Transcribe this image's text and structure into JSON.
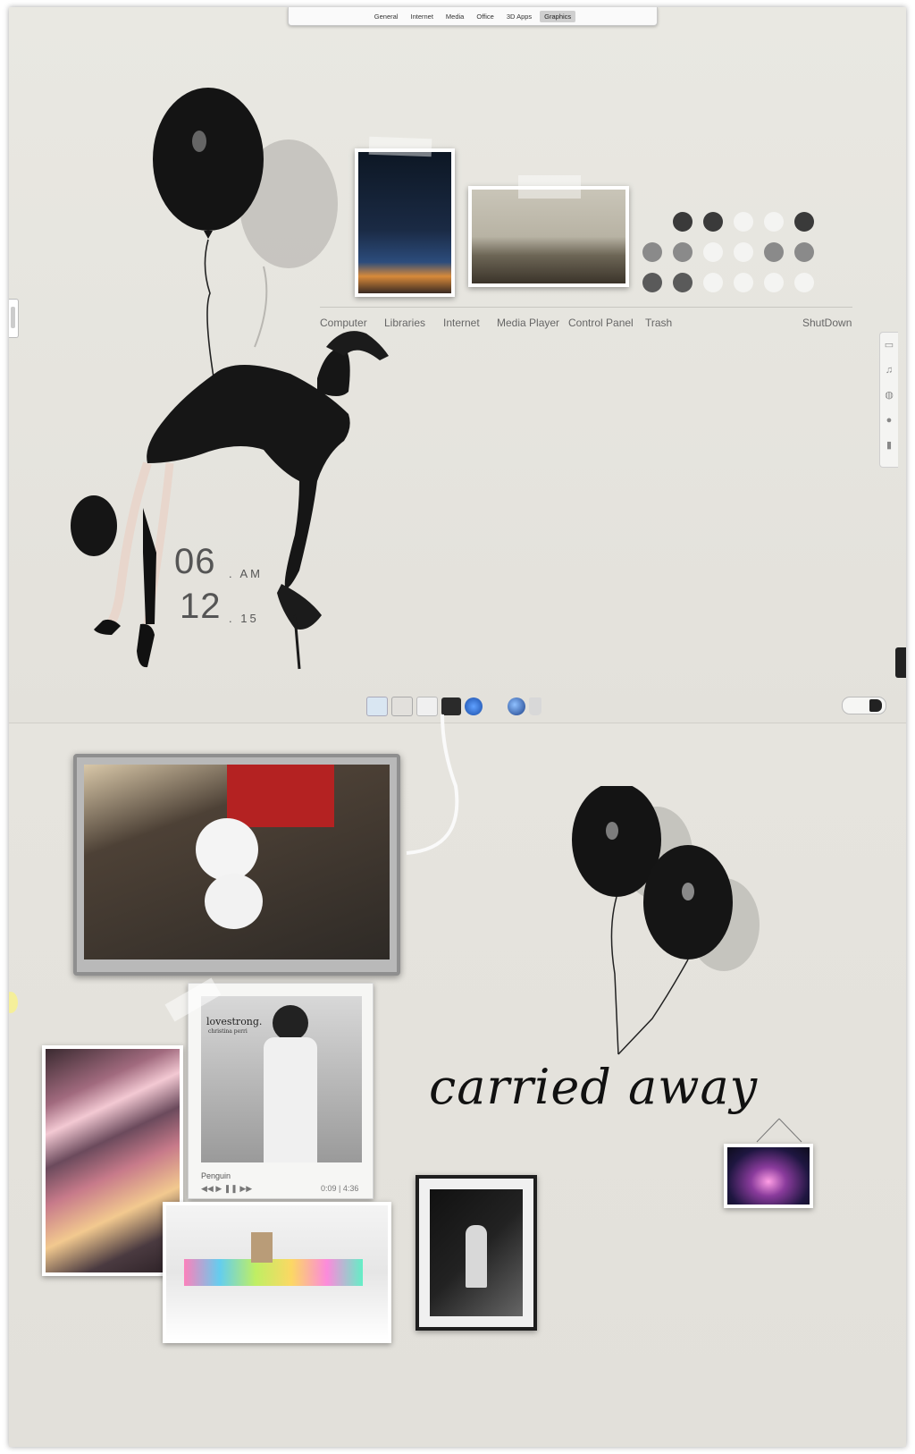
{
  "top_tabs": [
    {
      "label": "General",
      "active": false
    },
    {
      "label": "Internet",
      "active": false
    },
    {
      "label": "Media",
      "active": false
    },
    {
      "label": "Office",
      "active": false
    },
    {
      "label": "3D Apps",
      "active": false
    },
    {
      "label": "Graphics",
      "active": true
    }
  ],
  "launcher": {
    "items": [
      "Computer",
      "Libraries",
      "Internet",
      "Media Player",
      "Control Panel",
      "Trash"
    ],
    "shutdown_label": "ShutDown"
  },
  "clock": {
    "hour": "06",
    "ampm": ". AM",
    "minute": "12",
    "seconds": ". 15"
  },
  "right_bar_icons": [
    "monitor-icon",
    "music-icon",
    "globe-icon",
    "chat-icon",
    "trash-icon"
  ],
  "dock_icons": [
    "skype-icon",
    "photos-icon",
    "documents-icon",
    "media-icon",
    "refresh-icon",
    "globe-icon",
    "trash-icon"
  ],
  "music_widget": {
    "album_title": "lovestrong.",
    "album_artist": "christina perri",
    "track": "Penguin",
    "time": "0:09 | 4:36"
  },
  "tagline": {
    "text": "carried away"
  },
  "colors": {
    "background": "#e6e4de",
    "balloon": "#111111",
    "dot_dark": "#3a3a3a",
    "dot_mid": "#8a8a8a",
    "dot_light": "#f2f2f2"
  }
}
